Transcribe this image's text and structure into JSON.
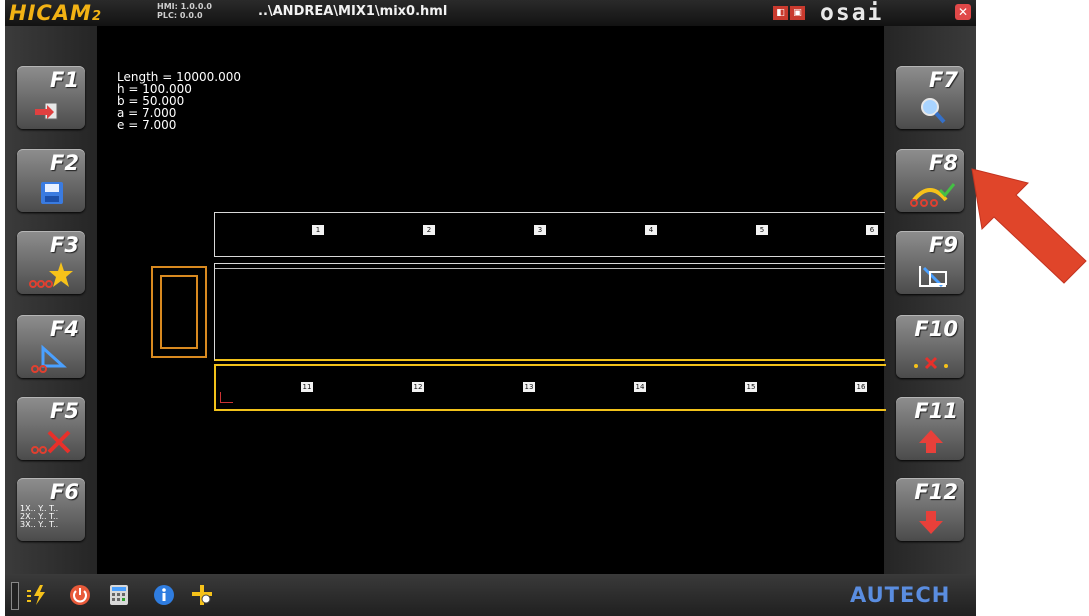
{
  "app": {
    "logo": "HICAM",
    "logo_sub": "2",
    "hmi_version": "HMI: 1.0.0.0",
    "plc_version": "PLC: 0.0.0",
    "file_path": "..\\ANDREA\\MIX1\\mix0.hml",
    "brand": "osai"
  },
  "params": {
    "text": "Length = 10000.000\nh = 100.000\nb = 50.000\na = 7.000\ne = 7.000"
  },
  "left_keys": [
    {
      "label": "F1",
      "icon": "import-icon"
    },
    {
      "label": "F2",
      "icon": "save-floppy-icon"
    },
    {
      "label": "F3",
      "icon": "new-star-icon"
    },
    {
      "label": "F4",
      "icon": "square-tool-icon"
    },
    {
      "label": "F5",
      "icon": "delete-cross-icon"
    },
    {
      "label": "F6",
      "icon": "coordinates-list-icon"
    }
  ],
  "right_keys": [
    {
      "label": "F7",
      "icon": "zoom-magnifier-icon"
    },
    {
      "label": "F8",
      "icon": "check-path-icon"
    },
    {
      "label": "F9",
      "icon": "measure-icon"
    },
    {
      "label": "F10",
      "icon": "remove-point-icon"
    },
    {
      "label": "F11",
      "icon": "arrow-up-icon"
    },
    {
      "label": "F12",
      "icon": "arrow-down-icon"
    }
  ],
  "beams": {
    "top_labels": [
      "1",
      "2",
      "3",
      "4",
      "5",
      "6"
    ],
    "bottom_labels": [
      "11",
      "12",
      "13",
      "14",
      "15",
      "16"
    ]
  },
  "f6_icon_text": "1X.. Y.. T..\n2X.. Y.. T..\n3X.. Y.. T..",
  "footer": {
    "brand": "AUTECH"
  },
  "colors": {
    "accent_yellow": "#f2c21a",
    "outline_orange": "#d98a20",
    "marker_red": "#cc3333",
    "arrow_red": "#e0452a"
  }
}
